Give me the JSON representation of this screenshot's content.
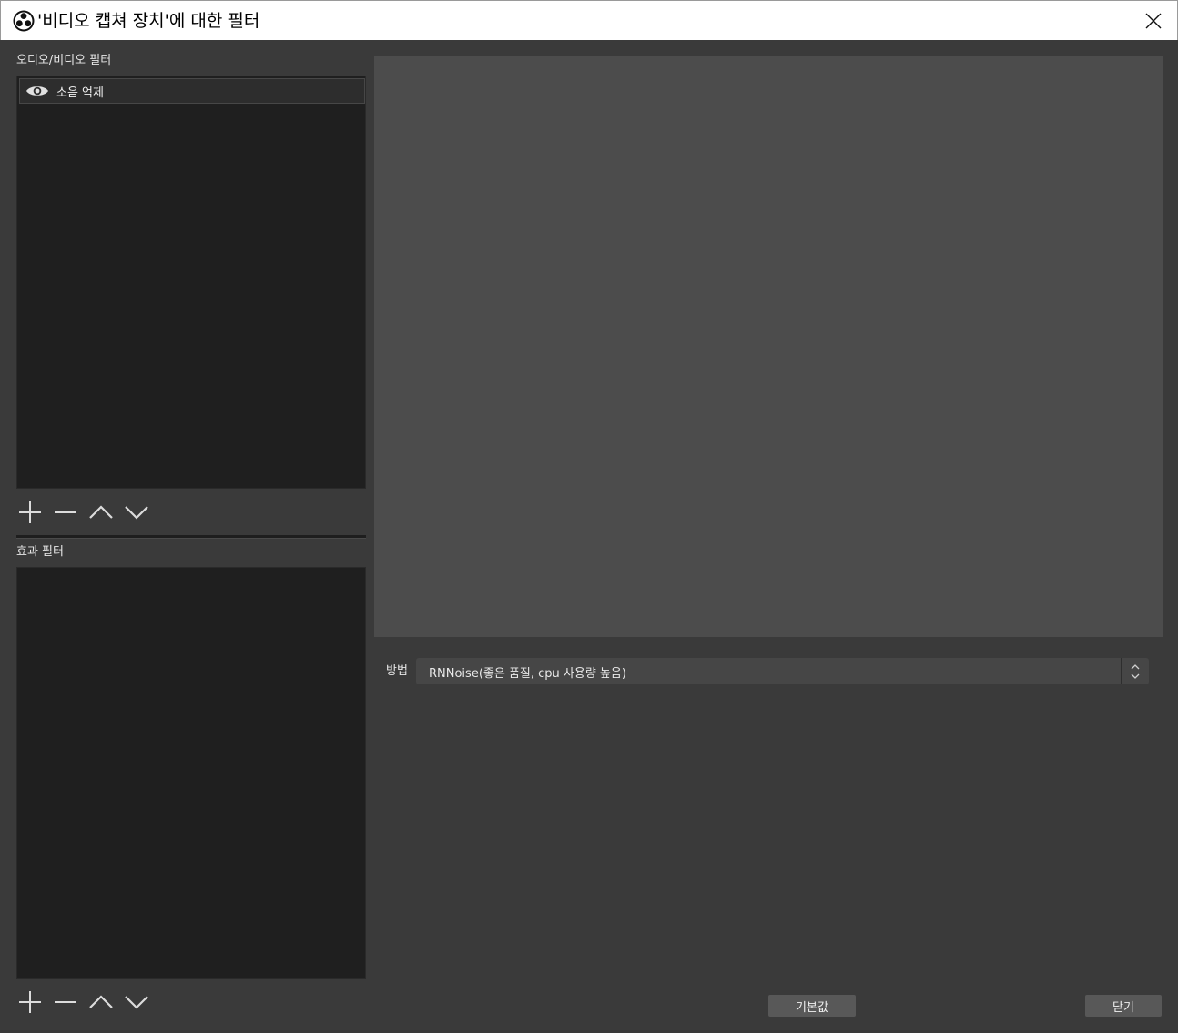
{
  "window": {
    "title": "'비디오 캡쳐 장치'에 대한 필터"
  },
  "audio_video_filters": {
    "label": "오디오/비디오 필터",
    "items": [
      {
        "label": "소음 억제",
        "visible": true
      }
    ]
  },
  "effect_filters": {
    "label": "효과 필터",
    "items": []
  },
  "toolbar_icons": [
    "plus-icon",
    "minus-icon",
    "arrow-up-icon",
    "arrow-down-icon"
  ],
  "properties": {
    "method_label": "방법",
    "method_value": "RNNoise(좋은 품질, cpu 사용량 높음)"
  },
  "buttons": {
    "defaults": "기본값",
    "close": "닫기"
  },
  "colors": {
    "background": "#3a3a3a",
    "list_background": "#1f1f1f",
    "preview_background": "#4c4c4c",
    "titlebar": "#ffffff"
  }
}
